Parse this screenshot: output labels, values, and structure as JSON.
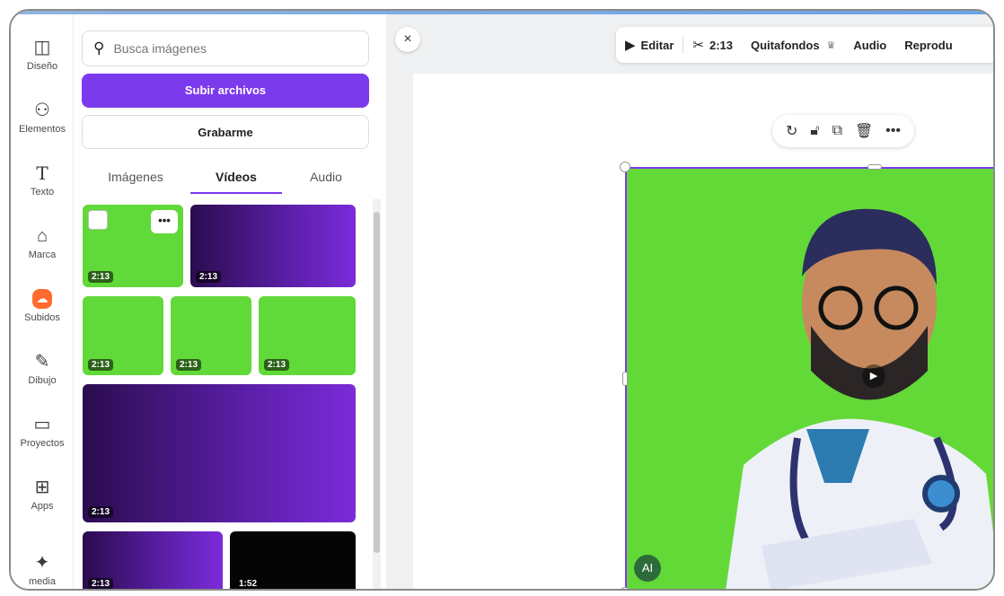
{
  "sidebar": {
    "items": [
      {
        "label": "Diseño",
        "icon": "layout-icon"
      },
      {
        "label": "Elementos",
        "icon": "shapes-icon"
      },
      {
        "label": "Texto",
        "icon": "text-icon"
      },
      {
        "label": "Marca",
        "icon": "brand-icon"
      },
      {
        "label": "Subidos",
        "icon": "cloud-upload-icon",
        "active": true
      },
      {
        "label": "Dibujo",
        "icon": "pen-icon"
      },
      {
        "label": "Proyectos",
        "icon": "folder-icon"
      },
      {
        "label": "Apps",
        "icon": "apps-icon"
      },
      {
        "label": "media",
        "icon": "magic-media-icon"
      }
    ]
  },
  "panel": {
    "search_placeholder": "Busca imágenes",
    "upload_label": "Subir archivos",
    "record_label": "Grabarme",
    "tabs": [
      "Imágenes",
      "Vídeos",
      "Audio"
    ],
    "active_tab": "Vídeos",
    "videos": [
      {
        "duration": "2:13",
        "bg": "green"
      },
      {
        "duration": "2:13",
        "bg": "purple"
      },
      {
        "duration": "2:13",
        "bg": "green"
      },
      {
        "duration": "2:13",
        "bg": "green"
      },
      {
        "duration": "2:13",
        "bg": "green"
      },
      {
        "duration": "2:13",
        "bg": "purple"
      },
      {
        "duration": "2:13",
        "bg": "purple"
      },
      {
        "duration": "1:52",
        "bg": "black"
      }
    ],
    "more_label": "•••"
  },
  "toolbar": {
    "edit_label": "Editar",
    "trim_label": "2:13",
    "bg_remover_label": "Quitafondos",
    "audio_label": "Audio",
    "playback_label": "Reprodu"
  },
  "canvas": {
    "close_label": "×",
    "badge_label": "AI"
  },
  "colors": {
    "accent": "#7c3aed",
    "green_screen": "#63d938",
    "active_rail": "#ff6b2c"
  }
}
